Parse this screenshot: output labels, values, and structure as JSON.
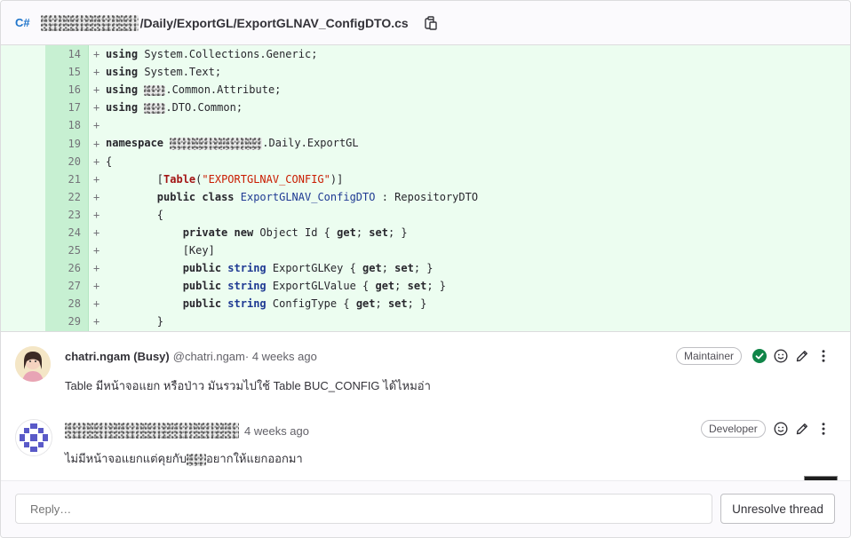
{
  "file": {
    "language_icon": "C#",
    "path_suffix": "/Daily/ExportGL/ExportGLNAV_ConfigDTO.cs",
    "copy_icon": "copy-icon"
  },
  "code": {
    "lines": [
      {
        "num": "14",
        "marker": "+"
      },
      {
        "num": "15",
        "marker": "+"
      },
      {
        "num": "16",
        "marker": "+"
      },
      {
        "num": "17",
        "marker": "+"
      },
      {
        "num": "18",
        "marker": "+"
      },
      {
        "num": "19",
        "marker": "+"
      },
      {
        "num": "20",
        "marker": "+"
      },
      {
        "num": "21",
        "marker": "+"
      },
      {
        "num": "22",
        "marker": "+"
      },
      {
        "num": "23",
        "marker": "+"
      },
      {
        "num": "24",
        "marker": "+"
      },
      {
        "num": "25",
        "marker": "+"
      },
      {
        "num": "26",
        "marker": "+"
      },
      {
        "num": "27",
        "marker": "+"
      },
      {
        "num": "28",
        "marker": "+"
      },
      {
        "num": "29",
        "marker": "+"
      }
    ],
    "tokens": {
      "using": "using",
      "collections": "System.Collections.Generic;",
      "text": "System.Text;",
      "common_attr": ".Common.Attribute;",
      "dto_common": ".DTO.Common;",
      "namespace": "namespace",
      "daily_export": ".Daily.ExportGL",
      "open_brace": "{",
      "close_brace": "}",
      "table_open": "[",
      "table_kw": "Table",
      "table_paren_open": "(",
      "table_str": "\"EXPORTGLNAV_CONFIG\"",
      "table_close": ")]",
      "public": "public",
      "class": "class",
      "class_name": "ExportGLNAV_ConfigDTO",
      "inherit": " : RepositoryDTO",
      "private": "private",
      "new": "new",
      "object_id": " Object Id { ",
      "get": "get",
      "set": "set",
      "key_attr": "[Key]",
      "string": "string",
      "export_key": " ExportGLKey { ",
      "export_value": " ExportGLValue { ",
      "config_type": " ConfigType { ",
      "semi_space": "; ",
      "semi_close": "; }"
    }
  },
  "comments": [
    {
      "author": "chatri.ngam (Busy)",
      "handle": "@chatri.ngam",
      "time": " · 4 weeks ago",
      "role": "Maintainer",
      "body": "Table มีหน้าจอแยก หรือป่าว มันรวมไปใช้ Table BUC_CONFIG ได้ไหมอ่า",
      "resolved_icon": "check-circle-icon",
      "emoji_icon": "smiley-icon",
      "edit_icon": "pencil-icon",
      "more_icon": "kebab-menu-icon"
    },
    {
      "time": "4 weeks ago",
      "role": "Developer",
      "body_before": "ไม่มีหน้าจอแยกแต่คุยกับ",
      "body_after": "อยากให้แยกออกมา",
      "emoji_icon": "smiley-icon",
      "edit_icon": "pencil-icon",
      "more_icon": "kebab-menu-icon"
    }
  ],
  "reply": {
    "placeholder": "Reply…",
    "resolve_label": "Unresolve thread"
  },
  "colors": {
    "added_bg": "#ecfdf0",
    "added_gutter": "#c7f0d2",
    "accent_blue": "#1f75cb",
    "resolved_green": "#108548"
  }
}
